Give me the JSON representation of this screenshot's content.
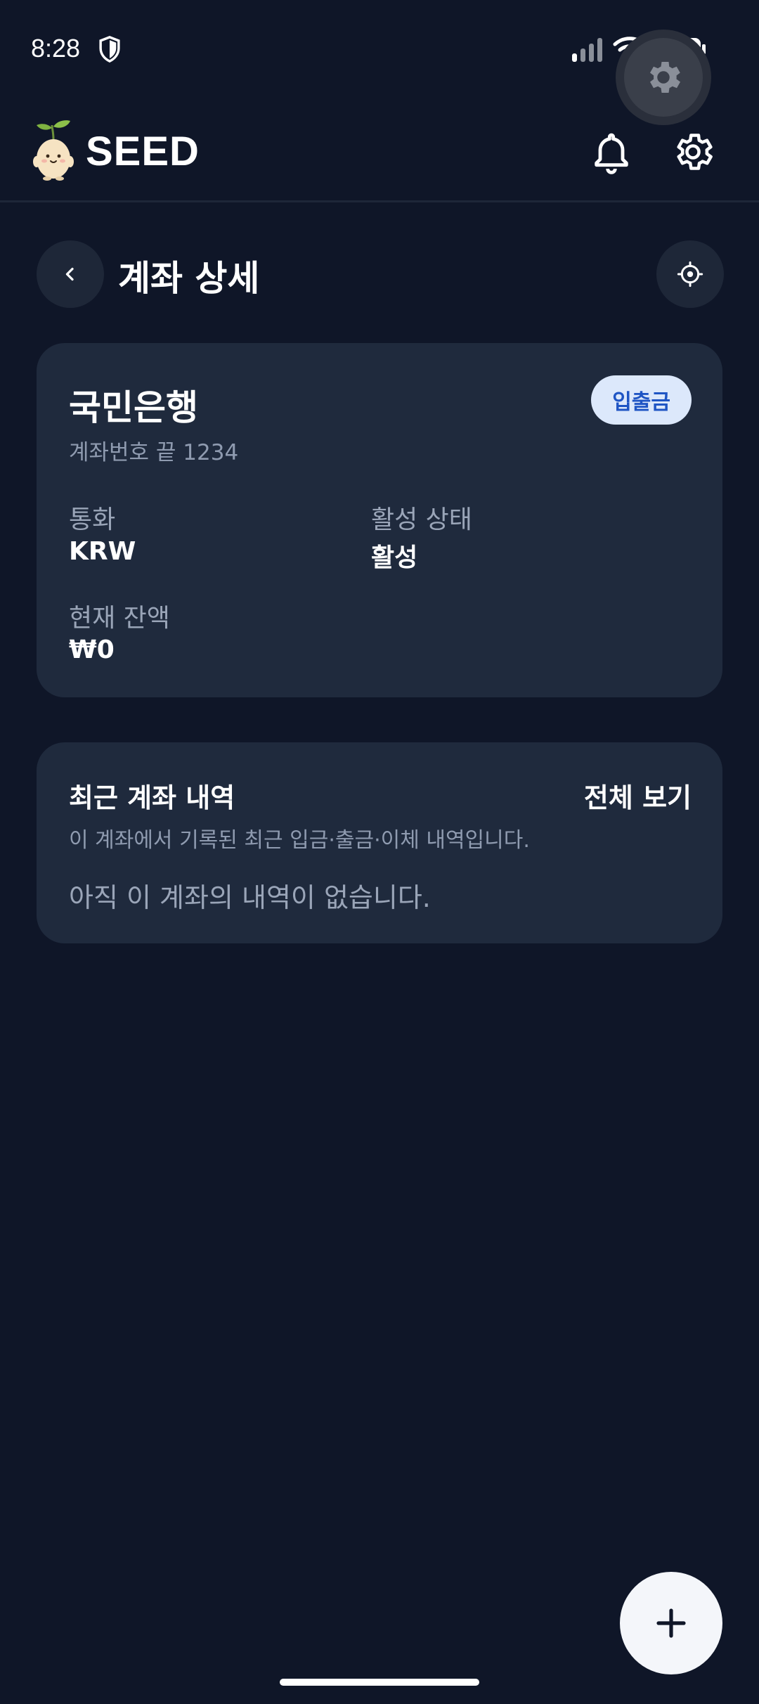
{
  "status_bar": {
    "time": "8:28"
  },
  "header": {
    "app_name": "SEED"
  },
  "page": {
    "title": "계좌 상세"
  },
  "account": {
    "bank_name": "국민은행",
    "type_badge": "입출금",
    "account_number": "계좌번호 끝 1234",
    "currency_label": "통화",
    "currency_value": "KRW",
    "status_label": "활성 상태",
    "status_value": "활성",
    "balance_label": "현재 잔액",
    "balance_value": "₩0"
  },
  "history": {
    "title": "최근 계좌 내역",
    "view_all": "전체 보기",
    "description": "이 계좌에서 기록된 최근 입금·출금·이체 내역입니다.",
    "empty_message": "아직 이 계좌의 내역이 없습니다."
  },
  "icons": {
    "shield": "shield-icon",
    "signal": "signal-icon",
    "wifi": "wifi-icon",
    "battery": "battery-icon",
    "bell": "bell-icon",
    "gear": "gear-icon",
    "back": "chevron-left-icon",
    "target": "crosshair-icon",
    "add": "plus-icon"
  },
  "colors": {
    "background": "#0f1628",
    "card": "#1f2a3d",
    "badge_bg": "#dce8fb",
    "badge_text": "#1f55c4",
    "muted_text": "#8f9bb0"
  }
}
